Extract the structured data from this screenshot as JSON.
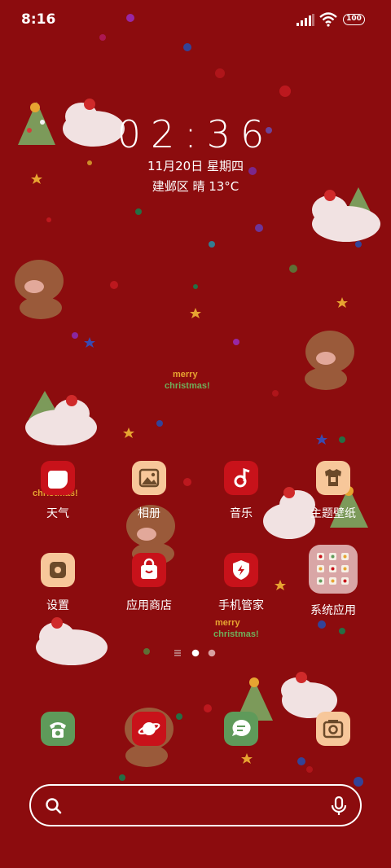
{
  "status_bar": {
    "time": "8:16",
    "battery": "100"
  },
  "clock": {
    "time": "02:36",
    "date": "11月20日 星期四",
    "weather": "建邺区 晴 13°C"
  },
  "apps_row1": [
    {
      "label": "天气",
      "icon": "weather-icon",
      "color": "#c8121a"
    },
    {
      "label": "相册",
      "icon": "gallery-icon",
      "color": "#f7c79a"
    },
    {
      "label": "音乐",
      "icon": "music-icon",
      "color": "#c8121a"
    },
    {
      "label": "主题壁纸",
      "icon": "themes-icon",
      "color": "#f7c79a"
    }
  ],
  "apps_row2": [
    {
      "label": "设置",
      "icon": "settings-icon",
      "color": "#f7c79a"
    },
    {
      "label": "应用商店",
      "icon": "app-store-icon",
      "color": "#c8121a"
    },
    {
      "label": "手机管家",
      "icon": "security-icon",
      "color": "#c8121a"
    },
    {
      "label": "系统应用",
      "icon": "system-folder-icon",
      "color": "#d9a6a6"
    }
  ],
  "dock": [
    {
      "name": "phone",
      "icon": "phone-icon",
      "color": "#5f9a5a"
    },
    {
      "name": "browser",
      "icon": "browser-icon",
      "color": "#c8121a"
    },
    {
      "name": "messages",
      "icon": "messages-icon",
      "color": "#5f9a5a"
    },
    {
      "name": "camera",
      "icon": "camera-icon",
      "color": "#f7c79a"
    }
  ],
  "wallpaper": {
    "background": "#8c0c0e",
    "text": "merry christmas!"
  }
}
